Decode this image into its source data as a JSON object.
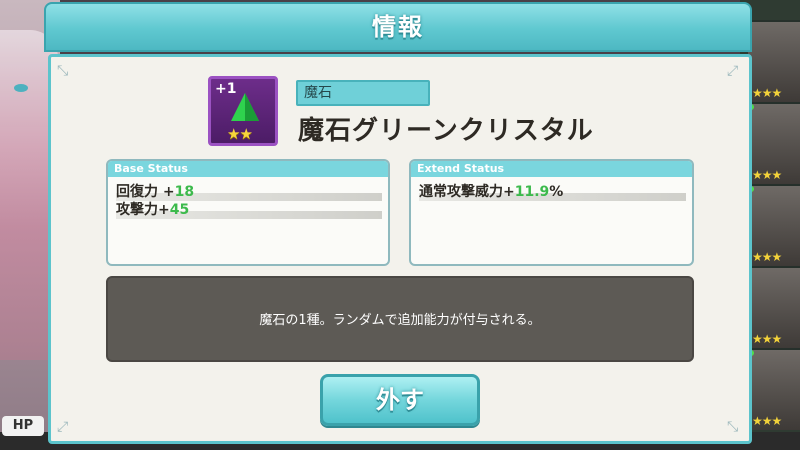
{
  "dialog": {
    "title": "情報"
  },
  "item": {
    "level": "+1",
    "stars": "★★",
    "category": "魔石",
    "name": "魔石グリーンクリスタル",
    "gem_color": "#2fd24e"
  },
  "base_status": {
    "header": "Base Status",
    "rows": [
      {
        "label": "回復力 +",
        "value": "18"
      },
      {
        "label": "攻撃力+",
        "value": "45"
      }
    ]
  },
  "extend_status": {
    "header": "Extend Status",
    "rows": [
      {
        "label": "通常攻撃威力+",
        "value": "11.9",
        "suffix": "%"
      }
    ]
  },
  "description": "魔石の1種。ランダムで追加能力が付与される。",
  "buttons": {
    "remove": "外す"
  },
  "background": {
    "hp_label": "HP",
    "cell_stars": "★★★"
  },
  "colors": {
    "accent": "#5fc8d0",
    "value_green": "#3cba4c"
  }
}
